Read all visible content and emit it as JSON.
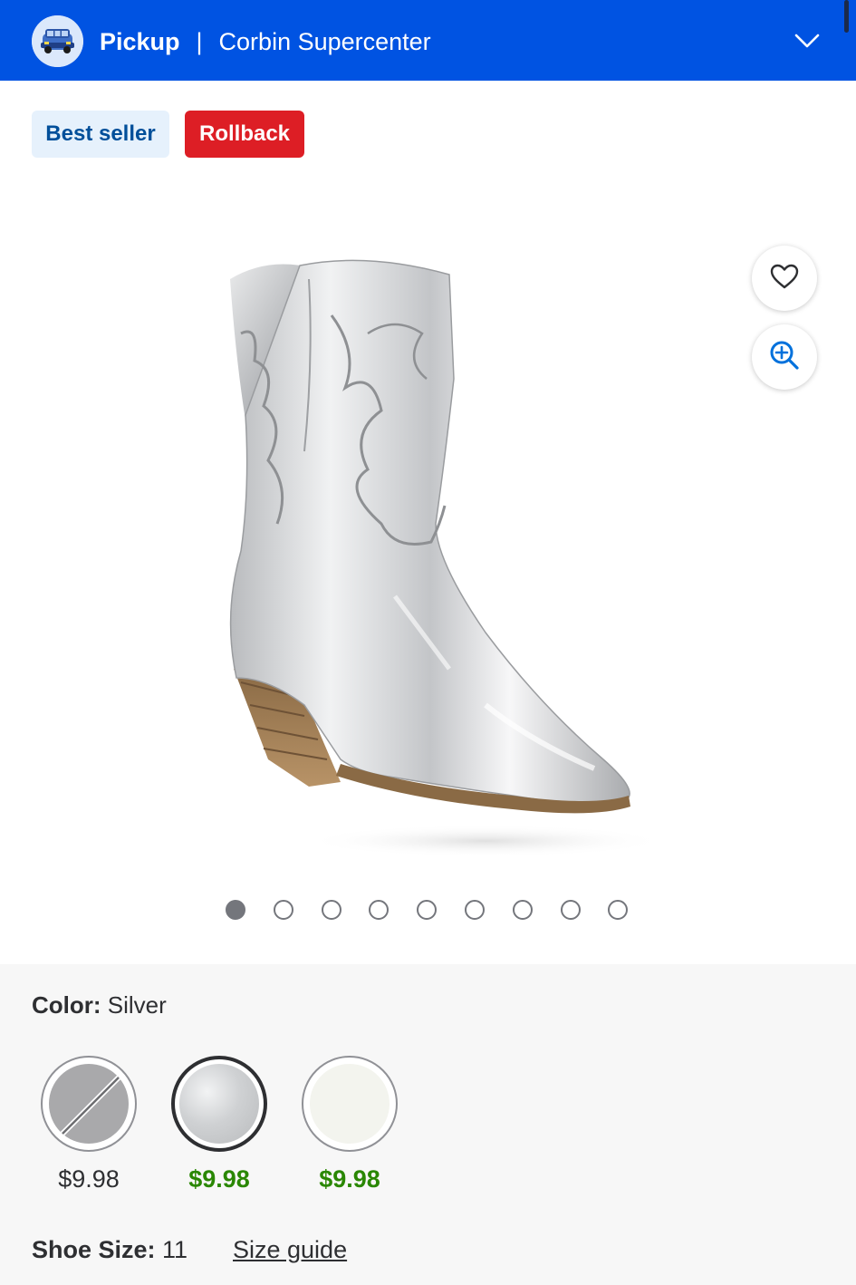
{
  "header": {
    "mode_label": "Pickup",
    "separator": "|",
    "store_name": "Corbin Supercenter",
    "background_color": "#0053e2"
  },
  "badges": {
    "best_seller": "Best seller",
    "rollback": "Rollback"
  },
  "product_image": {
    "description": "silver western boot",
    "carousel_total": 9,
    "carousel_active_index": 0
  },
  "actions": {
    "favorite_icon": "heart-icon",
    "zoom_icon": "zoom-in-icon"
  },
  "color": {
    "label": "Color:",
    "value": "Silver",
    "swatches": [
      {
        "price": "$9.98",
        "available": false,
        "selected": false,
        "swatch_color": "#a9a9ab"
      },
      {
        "price": "$9.98",
        "available": true,
        "selected": true,
        "swatch_color": "#d5d6d8"
      },
      {
        "price": "$9.98",
        "available": true,
        "selected": false,
        "swatch_color": "#f3f4ee"
      }
    ]
  },
  "size": {
    "label": "Shoe Size:",
    "value": "11",
    "guide_link": "Size guide"
  },
  "colors": {
    "accent_blue": "#0053e2",
    "rollback_red": "#dd1e25",
    "price_green": "#2a8703"
  }
}
